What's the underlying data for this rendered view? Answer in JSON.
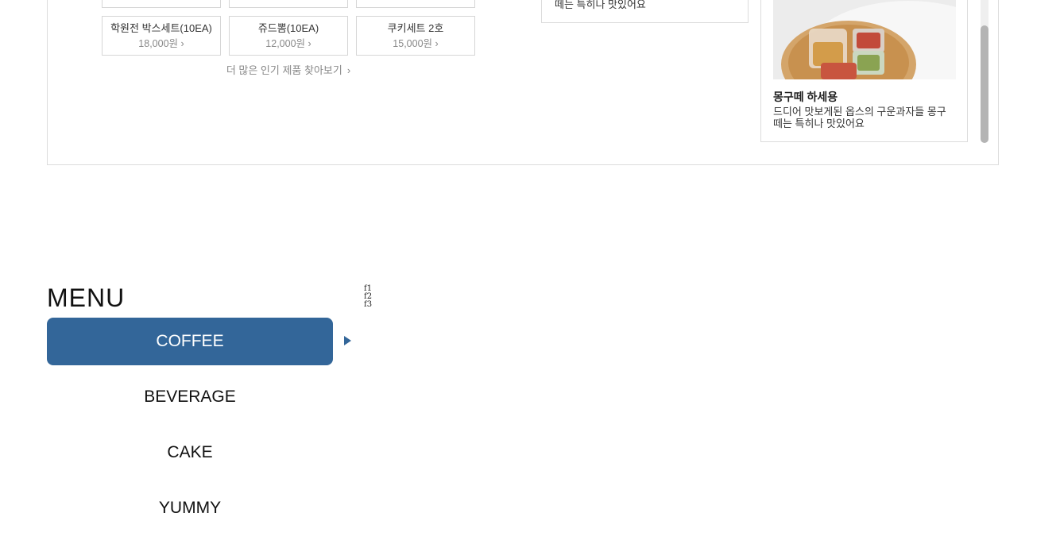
{
  "popular_products": {
    "items": [
      {
        "name": "학원전 박스세트(10EA)",
        "price": "18,000원"
      },
      {
        "name": "쥬드뽐(10EA)",
        "price": "12,000원"
      },
      {
        "name": "쿠키세트 2호",
        "price": "15,000원"
      }
    ],
    "more_link": "더 많은 인기 제품 찾아보기"
  },
  "review_partial": {
    "text": "떼는 특히나 맛있어요"
  },
  "feed": {
    "title": "몽구떼 하세용",
    "desc": "드디어 맛보게된 옵스의 구운과자들 몽구떼는 특히나 맛있어요"
  },
  "menu": {
    "title": "MENU",
    "items": [
      "COFFEE",
      "BEVERAGE",
      "CAKE",
      "YUMMY"
    ],
    "active": "COFFEE",
    "accent_color": "#336699"
  },
  "footnotes": [
    "f1",
    "f2",
    "f3"
  ],
  "icons": {
    "chevron": "chevron-right-icon",
    "arrow": "triangle-right-icon"
  }
}
